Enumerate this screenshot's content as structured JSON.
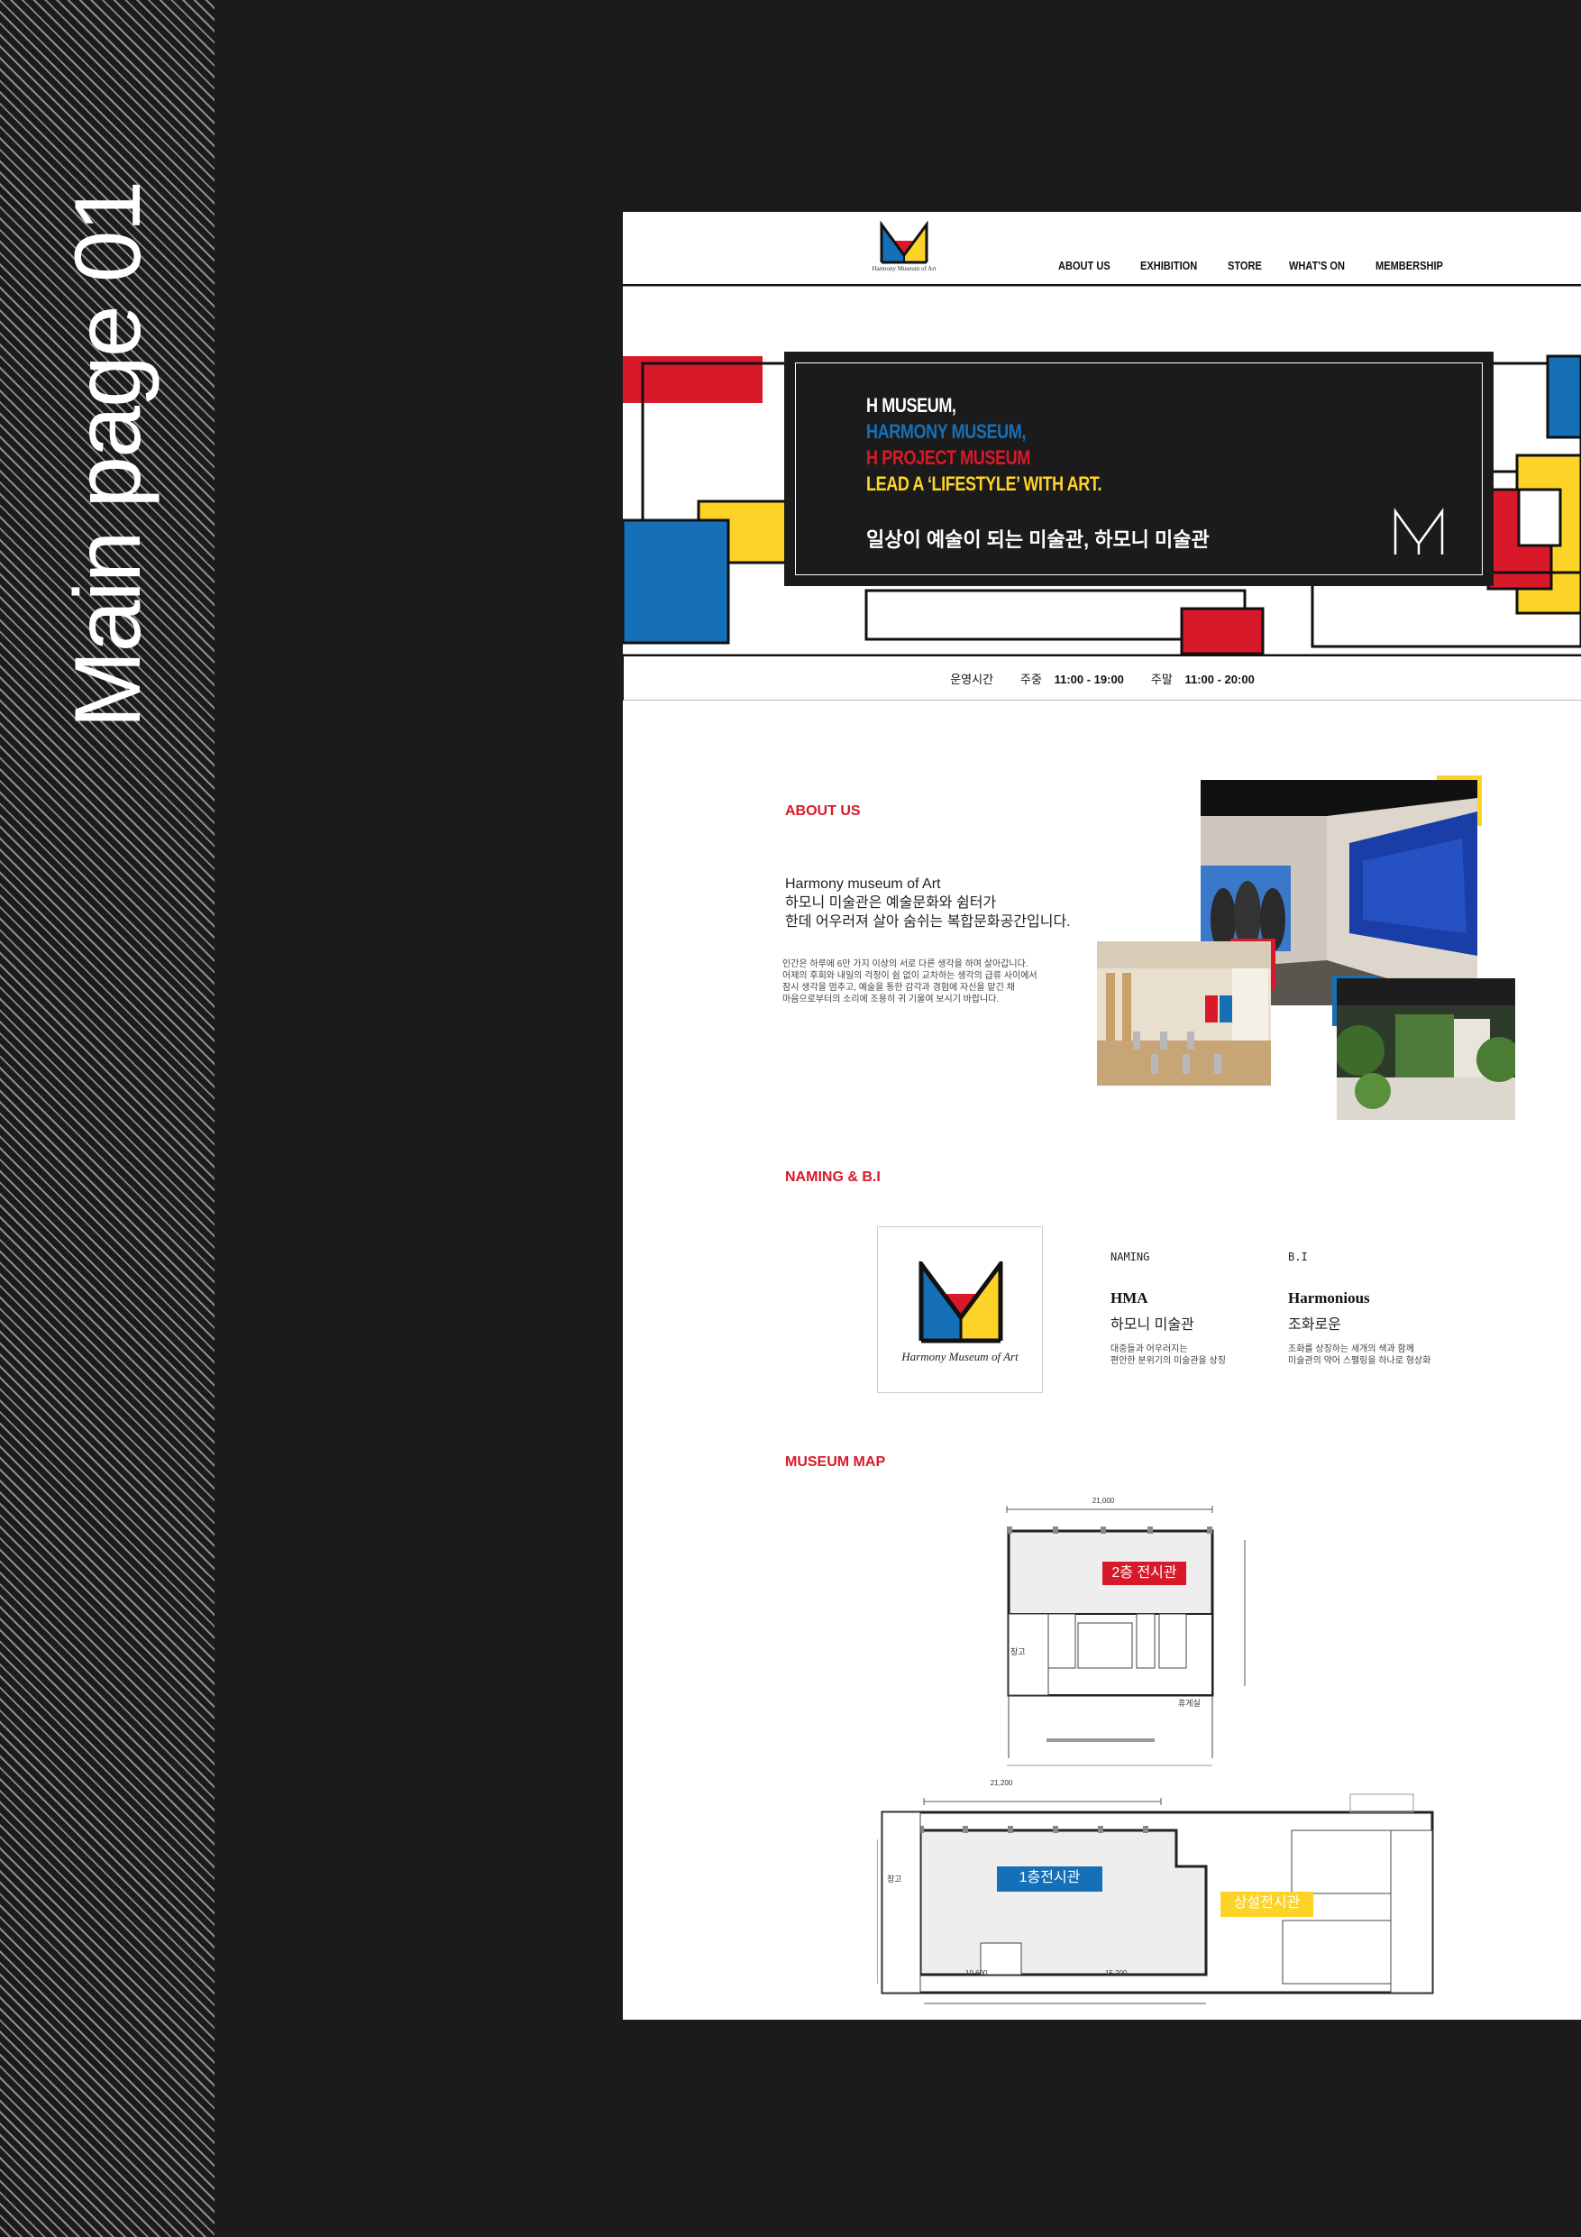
{
  "sidebar": {
    "title": "Main page 01"
  },
  "header": {
    "logo_caption": "Harmony Museum of Art",
    "nav": [
      "ABOUT US",
      "EXHIBITION",
      "STORE",
      "WHAT'S ON",
      "MEMBERSHIP"
    ]
  },
  "hero": {
    "line1": "H MUSEUM,",
    "line2": "HARMONY MUSEUM,",
    "line3": "H PROJECT MUSEUM",
    "line4": "LEAD A ‘LIFESTYLE’ WITH ART.",
    "tagline": "일상이 예술이 되는 미술관, 하모니 미술관"
  },
  "hours": {
    "label": "운영시간",
    "weekday_label": "주중",
    "weekday_time": "11:00 - 19:00",
    "weekend_label": "주말",
    "weekend_time": "11:00 - 20:00"
  },
  "about": {
    "label": "ABOUT US",
    "heading_line1": "Harmony museum of Art",
    "heading_line2": "하모니 미술관은 예술문화와 쉼터가",
    "heading_line3": "한데 어우러져 살아 숨쉬는 복합문화공간입니다.",
    "body_line1": "인간은 하루에 6만 가지 이상의 서로 다른 생각을 하며 살아갑니다.",
    "body_line2": "어제의 후회와 내일의 걱정이 쉼 없이 교차하는 생각의 급류 사이에서",
    "body_line3": "잠시 생각을 멈추고, 예술을 통한 감각과 경험에 자신을 맡긴 채",
    "body_line4": "마음으로부터의 소리에 조용히 귀 기울여 보시기 바랍니다."
  },
  "naming": {
    "label": "NAMING & B.I",
    "logo_caption": "Harmony Museum of Art",
    "naming_head": "NAMING",
    "naming_title": "HMA",
    "naming_sub": "하모니 미술관",
    "naming_desc1": "대중들과 어우러지는",
    "naming_desc2": "편안한 분위기의 미술관을 상징",
    "bi_head": "B.I",
    "bi_title": "Harmonious",
    "bi_sub": "조화로운",
    "bi_desc1": "조화를 상징하는 세개의 색과 함께",
    "bi_desc2": "미술관의 약어 스펠링을 하나로 형상화"
  },
  "map": {
    "label": "MUSEUM MAP",
    "floor2_tag": "2층 전시관",
    "floor1_tag": "1층전시관",
    "permanent_tag": "상설전시관",
    "dim_top2": "21,000",
    "dim_top1": "21,200",
    "dim_bottom_a": "10,600",
    "dim_bottom_b": "15,200",
    "storage": "창고",
    "rest": "휴게실"
  },
  "colors": {
    "red": "#d8192a",
    "blue": "#1570b8",
    "yellow": "#fdd327",
    "dark": "#1b1b1b"
  }
}
